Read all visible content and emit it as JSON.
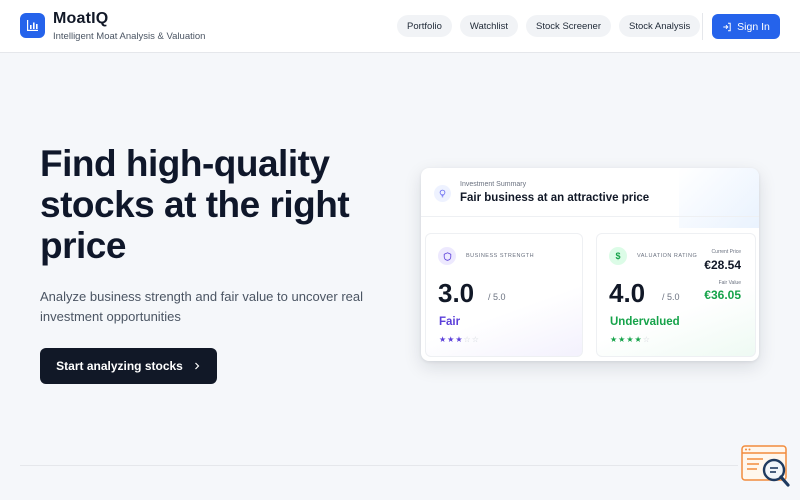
{
  "brand": {
    "name": "MoatIQ",
    "tagline": "Intelligent Moat Analysis & Valuation",
    "icon": "bar-chart-icon"
  },
  "nav": {
    "items": [
      {
        "label": "Portfolio"
      },
      {
        "label": "Watchlist"
      },
      {
        "label": "Stock Screener"
      },
      {
        "label": "Stock Analysis"
      }
    ],
    "signin_label": "Sign In"
  },
  "hero": {
    "title": "Find high-quality stocks at the right price",
    "subtitle": "Analyze business strength and fair value to uncover real investment opportunities",
    "cta_label": "Start analyzing stocks"
  },
  "summary": {
    "label": "Investment Summary",
    "title": "Fair business at an attractive price"
  },
  "business_strength": {
    "label": "BUSINESS STRENGTH",
    "score": "3.0",
    "scale": "/ 5.0",
    "rating": "Fair",
    "stars_filled": 3,
    "stars_total": 5
  },
  "valuation": {
    "label": "VALUATION RATING",
    "score": "4.0",
    "scale": "/ 5.0",
    "rating": "Undervalued",
    "stars_filled": 4,
    "stars_total": 5,
    "current_price_label": "Current Price",
    "current_price": "€28.54",
    "fair_value_label": "Fair Value",
    "fair_value": "€36.05"
  },
  "colors": {
    "accent": "#2563eb",
    "purple": "#5b3fd9",
    "green": "#16a34a",
    "dark": "#111827"
  }
}
